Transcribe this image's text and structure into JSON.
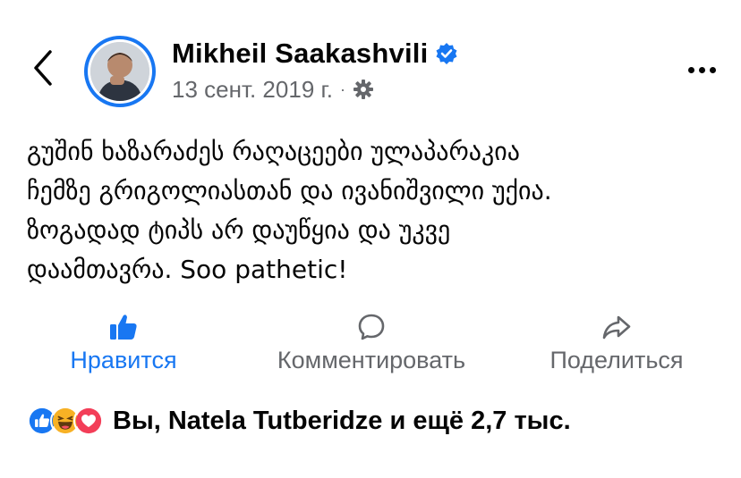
{
  "post": {
    "author_name": "Mikheil Saakashvili",
    "date": "13 сент. 2019 г.",
    "separator": "·",
    "text": "გუშინ ხაზარაძეს რაღაცეები ულაპარაკია\nჩემზე გრიგოლიასთან და ივანიშვილი უქია.\nზოგადად ტიპს არ დაუწყია და უკვე\nდაამთავრა. Soo pathetic!"
  },
  "actions": {
    "like_label": "Нравится",
    "comment_label": "Комментировать",
    "share_label": "Поделиться"
  },
  "reactions": {
    "icons": [
      "like-icon",
      "haha-icon",
      "love-icon"
    ],
    "summary": "Вы, Natela Tutberidze и ещё 2,7 тыс."
  },
  "colors": {
    "accent": "#1877f2",
    "secondary_text": "#65676b",
    "love": "#f33e58",
    "haha": "#f7b125"
  },
  "icons": {
    "back": "chevron-left-icon",
    "verified": "verified-badge-icon",
    "audience": "gear-icon",
    "more": "more-options-icon"
  }
}
